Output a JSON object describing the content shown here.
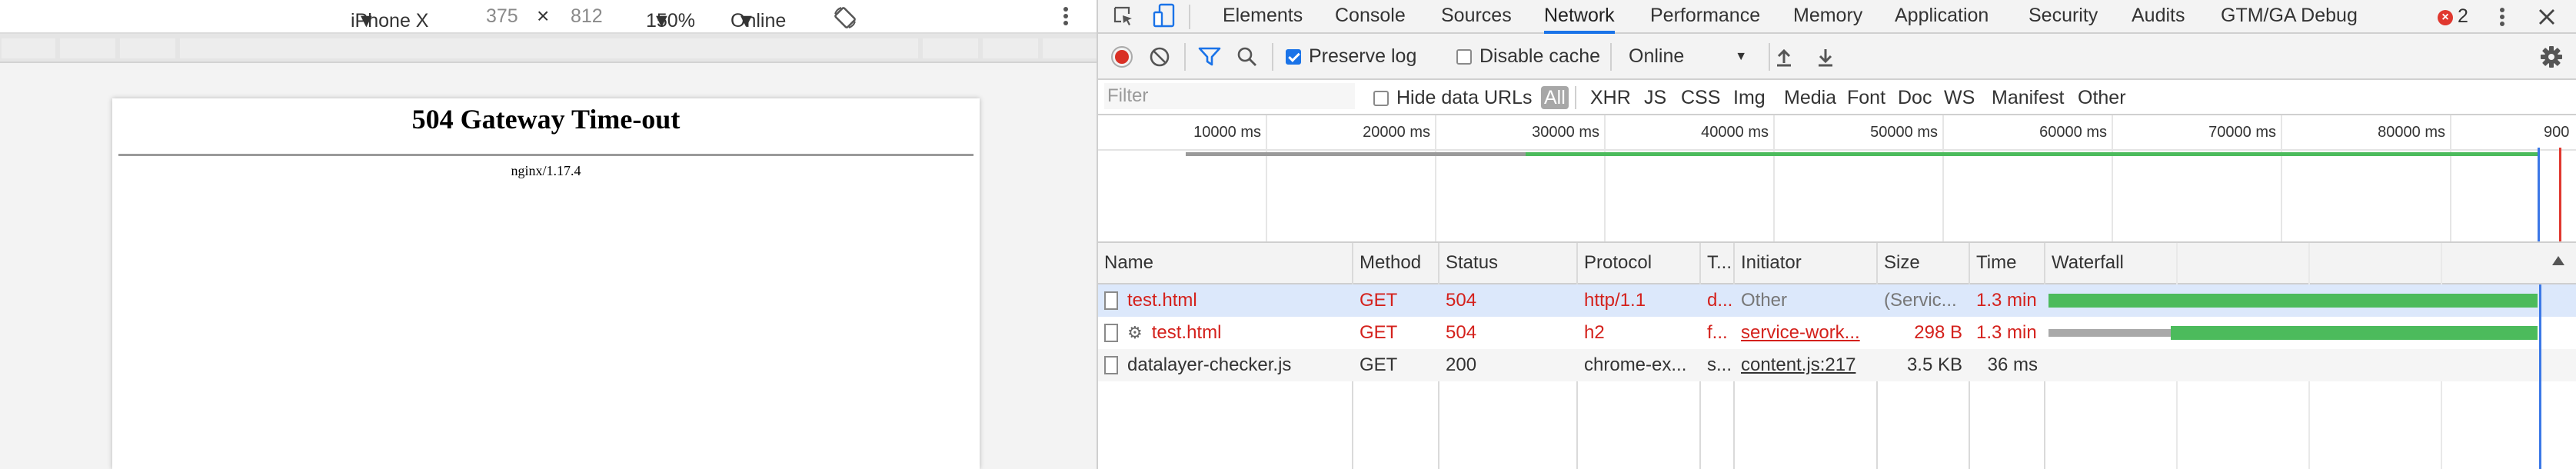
{
  "device_toolbar": {
    "device": "iPhone X",
    "width": "375",
    "times": "×",
    "height": "812",
    "zoom": "150%",
    "network": "Online"
  },
  "page": {
    "heading": "504 Gateway Time-out",
    "server": "nginx/1.17.4"
  },
  "devtools": {
    "tabs": [
      "Elements",
      "Console",
      "Sources",
      "Network",
      "Performance",
      "Memory",
      "Application",
      "Security",
      "Audits",
      "GTM/GA Debug"
    ],
    "active_tab": "Network",
    "error_count": "2",
    "toolbar": {
      "preserve_log": "Preserve log",
      "preserve_log_checked": true,
      "disable_cache": "Disable cache",
      "disable_cache_checked": false,
      "throttling": "Online"
    },
    "filter": {
      "placeholder": "Filter",
      "hide_data_urls": "Hide data URLs",
      "types": [
        "All",
        "XHR",
        "JS",
        "CSS",
        "Img",
        "Media",
        "Font",
        "Doc",
        "WS",
        "Manifest",
        "Other"
      ]
    },
    "overview_ticks": [
      "10000 ms",
      "20000 ms",
      "30000 ms",
      "40000 ms",
      "50000 ms",
      "60000 ms",
      "70000 ms",
      "80000 ms",
      "900"
    ],
    "columns": [
      "Name",
      "Method",
      "Status",
      "Protocol",
      "T...",
      "Initiator",
      "Size",
      "Time",
      "Waterfall"
    ],
    "requests": [
      {
        "name": "test.html",
        "method": "GET",
        "status": "504",
        "protocol": "http/1.1",
        "type": "d...",
        "initiator": "Other",
        "size": "(Servic...",
        "time": "1.3 min",
        "error": true,
        "waterfall_wait": 0.0,
        "waterfall_end": 1.0
      },
      {
        "name": "test.html",
        "method": "GET",
        "status": "504",
        "protocol": "h2",
        "type": "f...",
        "initiator": "service-work...",
        "size": "298 B",
        "time": "1.3 min",
        "error": true,
        "waterfall_wait": 0.25,
        "waterfall_end": 1.0
      },
      {
        "name": "datalayer-checker.js",
        "method": "GET",
        "status": "200",
        "protocol": "chrome-ex...",
        "type": "s...",
        "initiator": "content.js:217",
        "size": "3.5 KB",
        "time": "36 ms",
        "error": false
      }
    ],
    "colors": {
      "accent": "#1a73e8",
      "error": "#d4211c",
      "waterfall_green": "#4cbb5c",
      "record": "#d93025"
    }
  }
}
